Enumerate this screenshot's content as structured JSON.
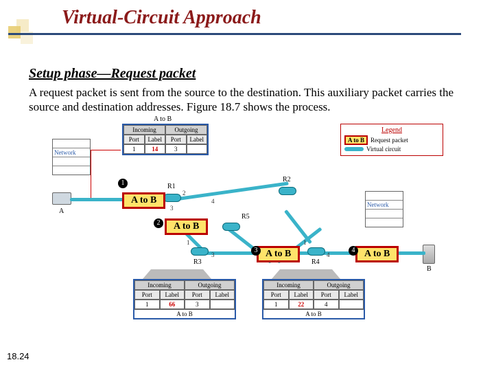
{
  "title": "Virtual-Circuit Approach",
  "subtitle": "Setup phase—Request packet",
  "body": "A request packet is sent from the source to the destination. This auxiliary packet carries the source and destination addresses. Figure 18.7 shows the process.",
  "pagenum": "18.24",
  "legend": {
    "title": "Legend",
    "req_chip": "A to B",
    "req_label": "Request packet",
    "vc_label": "Virtual circuit"
  },
  "net_label": "Network",
  "hostA": "A",
  "hostB": "B",
  "packet_label": "A to B",
  "steps": {
    "1": "1",
    "2": "2",
    "3": "3",
    "4": "4"
  },
  "routers": {
    "R1": "R1",
    "R2": "R2",
    "R3": "R3",
    "R4": "R4",
    "R5": "R5"
  },
  "table_R1": {
    "caption": "A to B",
    "incoming": "Incoming",
    "outgoing": "Outgoing",
    "port": "Port",
    "label": "Label",
    "row": {
      "in_port": "1",
      "in_label": "14",
      "out_port": "3",
      "out_label": ""
    }
  },
  "table_R3": {
    "caption": "A to B",
    "incoming": "Incoming",
    "outgoing": "Outgoing",
    "port": "Port",
    "label": "Label",
    "row": {
      "in_port": "1",
      "in_label": "66",
      "out_port": "3",
      "out_label": ""
    }
  },
  "table_R4": {
    "caption": "A to B",
    "incoming": "Incoming",
    "outgoing": "Outgoing",
    "port": "Port",
    "label": "Label",
    "row": {
      "in_port": "1",
      "in_label": "22",
      "out_port": "4",
      "out_label": ""
    }
  },
  "ports": {
    "p1": "1",
    "p2": "2",
    "p3": "3",
    "p4": "4"
  },
  "chart_data": {
    "type": "diagram",
    "title": "Setup phase — Request packet (Figure 18.7)",
    "nodes": [
      "A",
      "R1",
      "R2",
      "R3",
      "R4",
      "R5",
      "B"
    ],
    "request_path": [
      "A",
      "R1",
      "R3",
      "R4",
      "B"
    ],
    "step_labels": {
      "A→R1": 1,
      "R1→R3": 2,
      "R3→R4": 3,
      "R4→B": 4
    },
    "router_tables": {
      "R1": {
        "incoming": {
          "port": 1,
          "label": 14
        },
        "outgoing": {
          "port": 3,
          "label": null
        }
      },
      "R3": {
        "incoming": {
          "port": 1,
          "label": 66
        },
        "outgoing": {
          "port": 3,
          "label": null
        }
      },
      "R4": {
        "incoming": {
          "port": 1,
          "label": 22
        },
        "outgoing": {
          "port": 4,
          "label": null
        }
      }
    }
  }
}
